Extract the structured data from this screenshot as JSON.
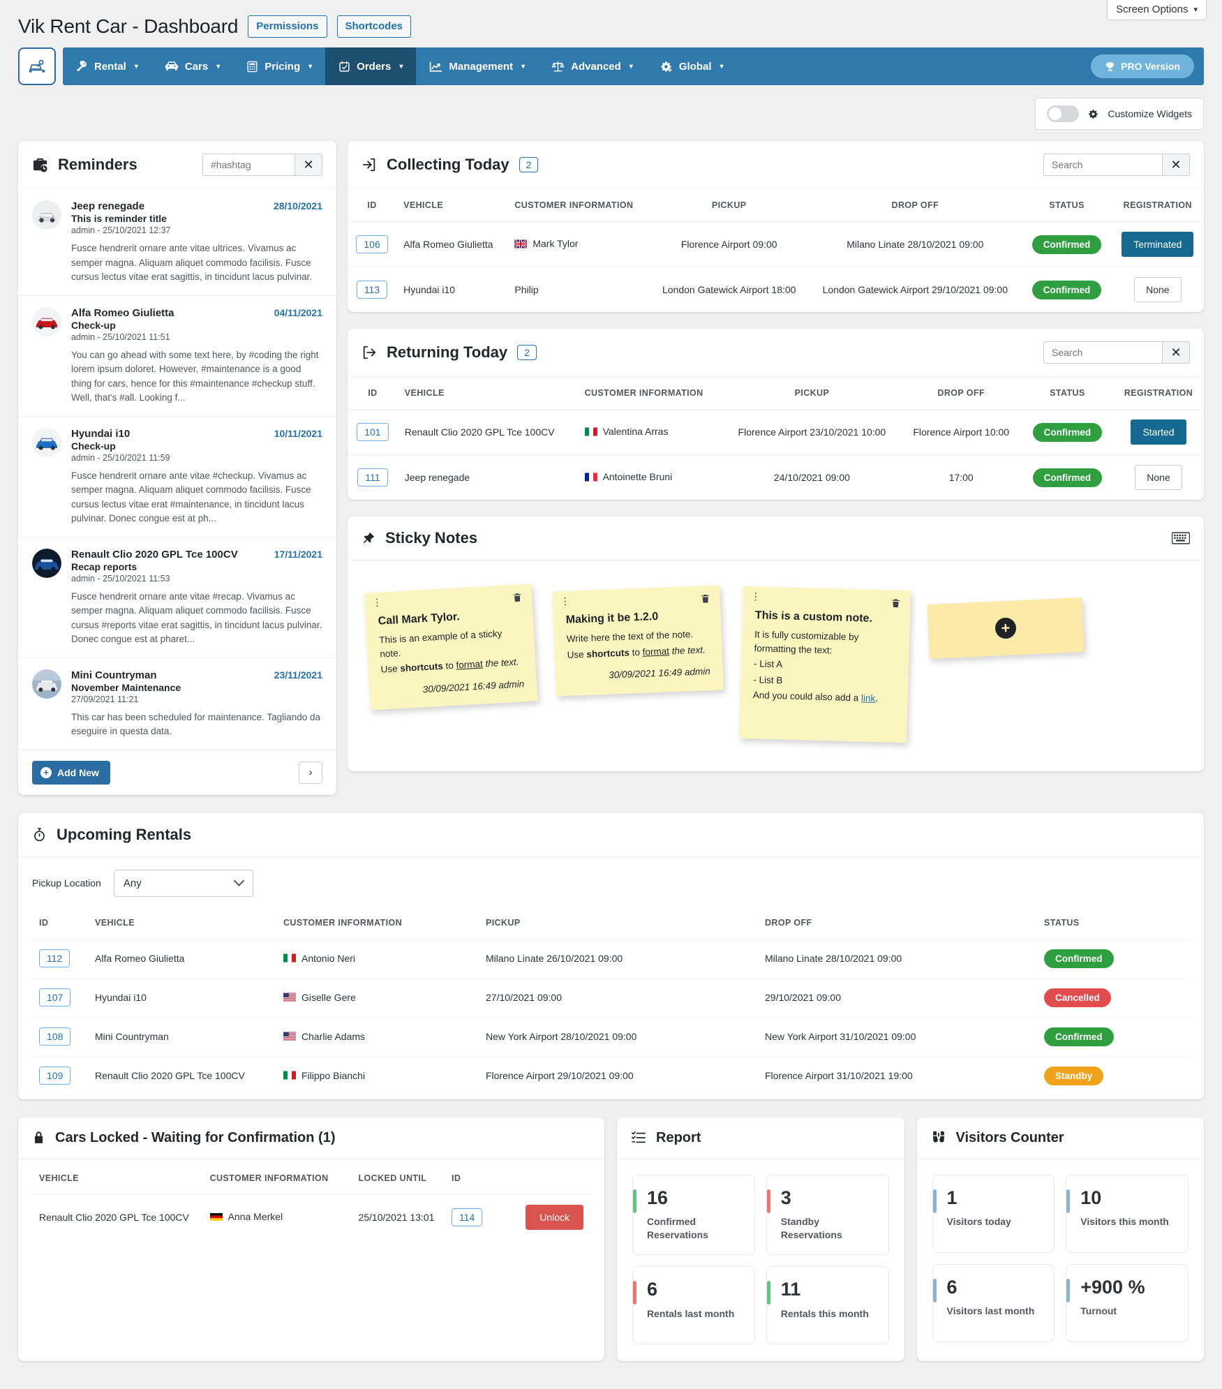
{
  "screen_options": {
    "label": "Screen Options",
    "caret": "▾"
  },
  "header": {
    "title": "Vik Rent Car - Dashboard",
    "buttons": [
      {
        "label": "Permissions",
        "name": "permissions-button"
      },
      {
        "label": "Shortcodes",
        "name": "shortcodes-button"
      }
    ]
  },
  "nav": {
    "items": [
      {
        "label": "Rental",
        "icon": "key-icon",
        "active": false
      },
      {
        "label": "Cars",
        "icon": "car-icon",
        "active": false
      },
      {
        "label": "Pricing",
        "icon": "calculator-icon",
        "active": false
      },
      {
        "label": "Orders",
        "icon": "calendar-check-icon",
        "active": true
      },
      {
        "label": "Management",
        "icon": "chart-line-icon",
        "active": false
      },
      {
        "label": "Advanced",
        "icon": "scales-icon",
        "active": false
      },
      {
        "label": "Global",
        "icon": "gears-icon",
        "active": false
      }
    ],
    "pro_label": "PRO Version",
    "accent": "#3079ad",
    "accent_active": "#1d4f71"
  },
  "customize": {
    "label": "Customize Widgets",
    "toggle_on": false
  },
  "reminders": {
    "title": "Reminders",
    "search_placeholder": "#hashtag",
    "search_value": "",
    "add_new_label": "Add New",
    "next_label": "›",
    "items": [
      {
        "vehicle": "Jeep renegade",
        "date": "28/10/2021",
        "subject": "This is reminder title",
        "meta": "admin - 25/10/2021 12:37",
        "text": "Fusce hendrerit ornare ante vitae ultrices. Vivamus ac semper magna. Aliquam aliquet commodo facilisis. Fusce cursus lectus vitae erat sagittis, in tincidunt lacus pulvinar."
      },
      {
        "vehicle": "Alfa Romeo Giulietta",
        "date": "04/11/2021",
        "subject": "Check-up",
        "meta": "admin - 25/10/2021 11:51",
        "text": "You can go ahead with some text here, by #coding the right lorem ipsum doloret. However, #maintenance is a good thing for cars, hence for this #maintenance #checkup stuff. Well, that's #all. Looking f..."
      },
      {
        "vehicle": "Hyundai i10",
        "date": "10/11/2021",
        "subject": "Check-up",
        "meta": "admin - 25/10/2021 11:59",
        "text": "Fusce hendrerit ornare ante vitae #checkup. Vivamus ac semper magna. Aliquam aliquet commodo facilisis. Fusce cursus lectus vitae erat #maintenance, in tincidunt lacus pulvinar. Donec congue est at ph..."
      },
      {
        "vehicle": "Renault Clio 2020 GPL Tce 100CV",
        "date": "17/11/2021",
        "subject": "Recap reports",
        "meta": "admin - 25/10/2021 11:53",
        "text": "Fusce hendrerit ornare ante vitae #recap. Vivamus ac semper magna. Aliquam aliquet commodo facilisis. Fusce cursus #reports vitae erat sagittis, in tincidunt lacus pulvinar. Donec congue est at pharet..."
      },
      {
        "vehicle": "Mini Countryman",
        "date": "23/11/2021",
        "subject": "November Maintenance",
        "meta": "27/09/2021 11:21",
        "text": "This car has been scheduled for maintenance. Tagliando da eseguire in questa data."
      }
    ]
  },
  "collecting": {
    "title": "Collecting Today",
    "count": "2",
    "search_placeholder": "Search",
    "search_value": "",
    "columns": [
      "ID",
      "VEHICLE",
      "CUSTOMER INFORMATION",
      "PICKUP",
      "DROP OFF",
      "STATUS",
      "REGISTRATION"
    ],
    "rows": [
      {
        "id": "106",
        "vehicle": "Alfa Romeo Giulietta",
        "customer": "Mark Tylor",
        "flag": "gb",
        "pickup": "Florence Airport 09:00",
        "dropoff": "Milano Linate 28/10/2021 09:00",
        "status": "Confirmed",
        "status_kind": "confirmed",
        "registration": "Terminated",
        "registration_kind": "solid"
      },
      {
        "id": "113",
        "vehicle": "Hyundai i10",
        "customer": "Philip",
        "flag": "none",
        "pickup": "London Gatewick Airport 18:00",
        "dropoff": "London Gatewick Airport 29/10/2021 09:00",
        "status": "Confirmed",
        "status_kind": "confirmed",
        "registration": "None",
        "registration_kind": "none"
      }
    ]
  },
  "returning": {
    "title": "Returning Today",
    "count": "2",
    "search_placeholder": "Search",
    "search_value": "",
    "columns": [
      "ID",
      "VEHICLE",
      "CUSTOMER INFORMATION",
      "PICKUP",
      "DROP OFF",
      "STATUS",
      "REGISTRATION"
    ],
    "rows": [
      {
        "id": "101",
        "vehicle": "Renault Clio 2020 GPL Tce 100CV",
        "customer": "Valentina Arras",
        "flag": "it",
        "pickup": "Florence Airport 23/10/2021 10:00",
        "dropoff": "Florence Airport 10:00",
        "status": "Confirmed",
        "status_kind": "confirmed",
        "registration": "Started",
        "registration_kind": "solid"
      },
      {
        "id": "111",
        "vehicle": "Jeep renegade",
        "customer": "Antoinette Bruni",
        "flag": "fr",
        "pickup": "24/10/2021 09:00",
        "dropoff": "17:00",
        "status": "Confirmed",
        "status_kind": "confirmed",
        "registration": "None",
        "registration_kind": "none"
      }
    ]
  },
  "sticky_notes": {
    "title": "Sticky Notes",
    "keyboard_icon": "keyboard-icon",
    "notes": [
      {
        "heading": "Call Mark Tylor.",
        "line1": "This is an example of a sticky note.",
        "line2_pre": "Use ",
        "line2_bold": "shortcuts",
        "line2_mid": " to ",
        "line2_underline": "format",
        "line2_post": " the text.",
        "signature": "30/09/2021 16:49 admin"
      },
      {
        "heading": "Making it be 1.2.0",
        "line1": "Write here the text of the note.",
        "line2_pre": "Use ",
        "line2_bold": "shortcuts",
        "line2_mid": " to ",
        "line2_underline": "format",
        "line2_post": " the text.",
        "signature": "30/09/2021 16:49 admin"
      },
      {
        "heading": "This is a custom note.",
        "body": "It is fully customizable by formatting the text:",
        "list": [
          "- List A",
          "- List B"
        ],
        "tail_pre": "And you could also add a ",
        "tail_link": "link",
        "tail_post": "."
      }
    ],
    "add_label": "+"
  },
  "upcoming": {
    "title": "Upcoming Rentals",
    "filter_label": "Pickup Location",
    "filter_value": "Any",
    "filter_options": [
      "Any"
    ],
    "columns": [
      "ID",
      "VEHICLE",
      "CUSTOMER INFORMATION",
      "PICKUP",
      "DROP OFF",
      "STATUS"
    ],
    "rows": [
      {
        "id": "112",
        "vehicle": "Alfa Romeo Giulietta",
        "customer": "Antonio Neri",
        "flag": "it",
        "pickup": "Milano Linate 26/10/2021 09:00",
        "dropoff": "Milano Linate 28/10/2021 09:00",
        "status": "Confirmed",
        "status_kind": "confirmed"
      },
      {
        "id": "107",
        "vehicle": "Hyundai i10",
        "customer": "Giselle Gere",
        "flag": "us",
        "pickup": "27/10/2021 09:00",
        "dropoff": "29/10/2021 09:00",
        "status": "Cancelled",
        "status_kind": "cancelled"
      },
      {
        "id": "108",
        "vehicle": "Mini Countryman",
        "customer": "Charlie Adams",
        "flag": "us",
        "pickup": "New York Airport 28/10/2021 09:00",
        "dropoff": "New York Airport 31/10/2021 09:00",
        "status": "Confirmed",
        "status_kind": "confirmed"
      },
      {
        "id": "109",
        "vehicle": "Renault Clio 2020 GPL Tce 100CV",
        "customer": "Filippo Bianchi",
        "flag": "it",
        "pickup": "Florence Airport 29/10/2021 09:00",
        "dropoff": "Florence Airport 31/10/2021 19:00",
        "status": "Standby",
        "status_kind": "standby"
      }
    ]
  },
  "cars_locked": {
    "title": "Cars Locked - Waiting for Confirmation (1)",
    "columns": [
      "VEHICLE",
      "CUSTOMER INFORMATION",
      "LOCKED UNTIL",
      "ID",
      ""
    ],
    "rows": [
      {
        "vehicle": "Renault Clio 2020 GPL Tce 100CV",
        "customer": "Anna Merkel",
        "flag": "de",
        "locked_until": "25/10/2021 13:01",
        "id": "114",
        "action": "Unlock"
      }
    ]
  },
  "report": {
    "title": "Report",
    "stats": [
      {
        "value": "16",
        "label": "Confirmed Reservations",
        "color": "#5cc97a"
      },
      {
        "value": "3",
        "label": "Standby Reservations",
        "color": "#f4736c"
      },
      {
        "value": "6",
        "label": "Rentals last month",
        "color": "#f4736c"
      },
      {
        "value": "11",
        "label": "Rentals this month",
        "color": "#5cc97a"
      }
    ]
  },
  "visitors": {
    "title": "Visitors Counter",
    "stats": [
      {
        "value": "1",
        "label": "Visitors today",
        "color": "#8bb3cf"
      },
      {
        "value": "10",
        "label": "Visitors this month",
        "color": "#8bb3cf"
      },
      {
        "value": "6",
        "label": "Visitors last month",
        "color": "#8bb3cf"
      },
      {
        "value": "+900 %",
        "label": "Turnout",
        "color": "#8bb3cf"
      }
    ]
  }
}
